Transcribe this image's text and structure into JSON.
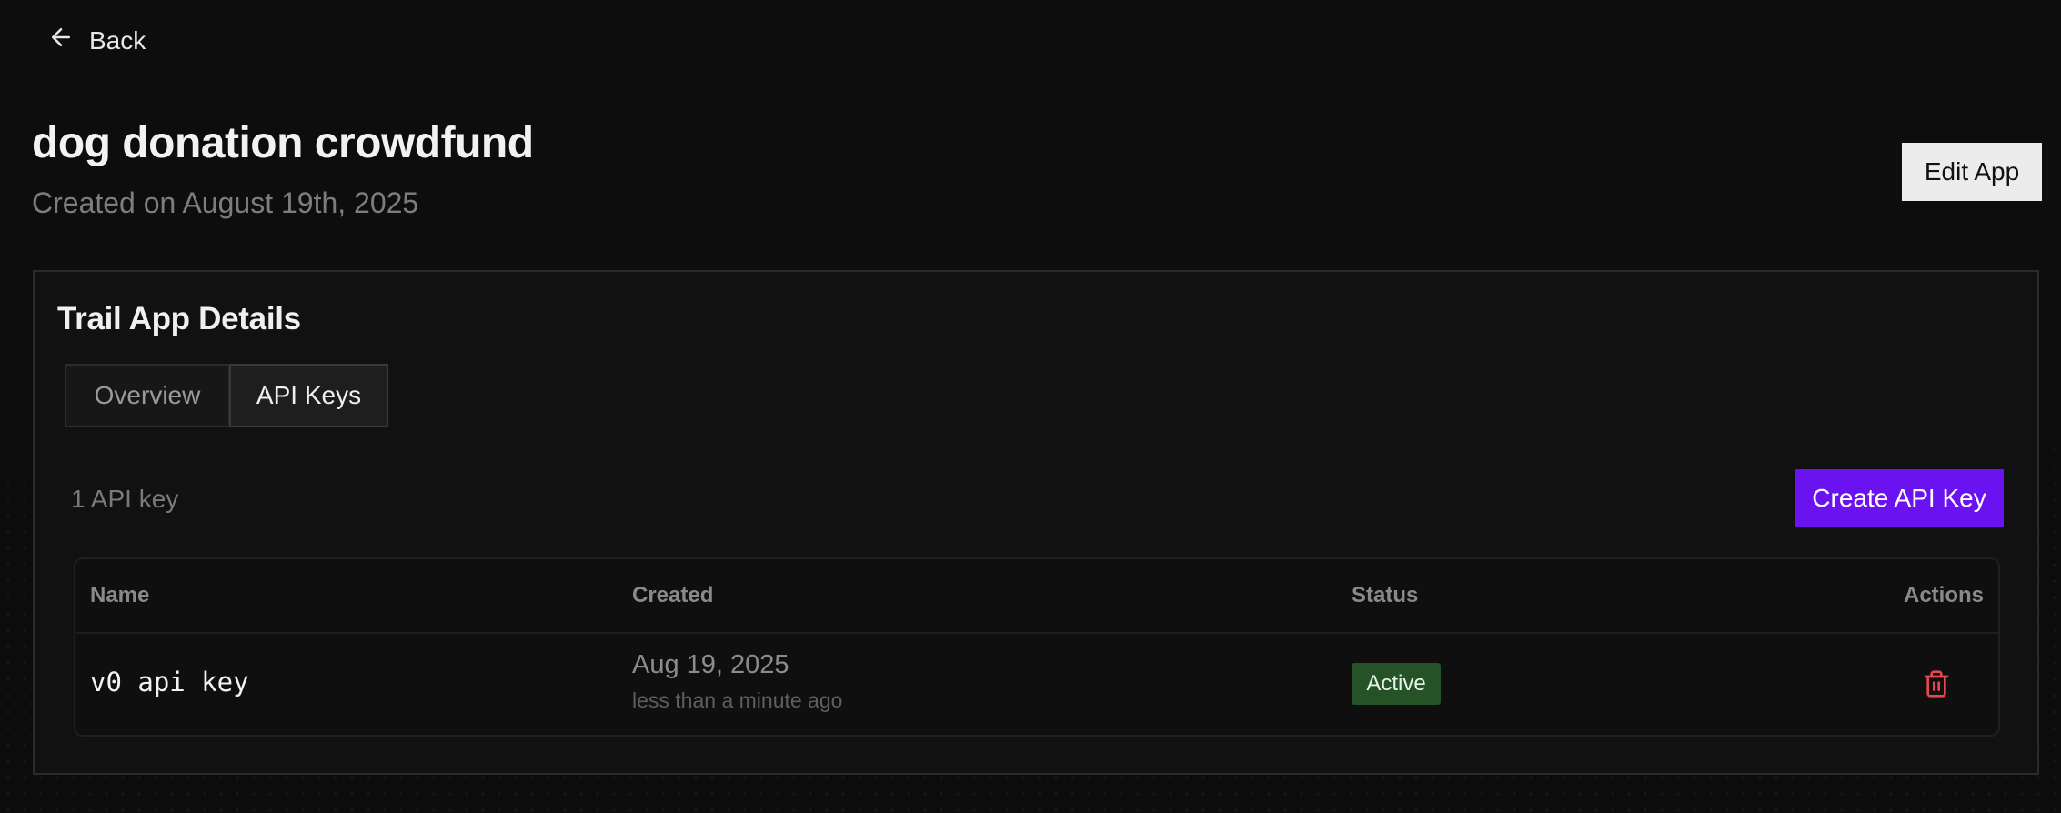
{
  "nav": {
    "back_label": "Back"
  },
  "app": {
    "title": "dog donation crowdfund",
    "created_label": "Created on August 19th, 2025",
    "edit_label": "Edit App"
  },
  "panel": {
    "title": "Trail App Details",
    "tabs": [
      {
        "label": "Overview",
        "active": false
      },
      {
        "label": "API Keys",
        "active": true
      }
    ],
    "count_label": "1 API key",
    "create_label": "Create API Key"
  },
  "table": {
    "headers": {
      "name": "Name",
      "created": "Created",
      "status": "Status",
      "actions": "Actions"
    },
    "rows": [
      {
        "name": "v0 api key",
        "created_date": "Aug 19, 2025",
        "created_relative": "less than a minute ago",
        "status": "Active",
        "action_icon": "trash-icon"
      }
    ]
  },
  "colors": {
    "accent": "#6a13f0",
    "status_active_bg": "#255227",
    "delete": "#e5484d"
  }
}
